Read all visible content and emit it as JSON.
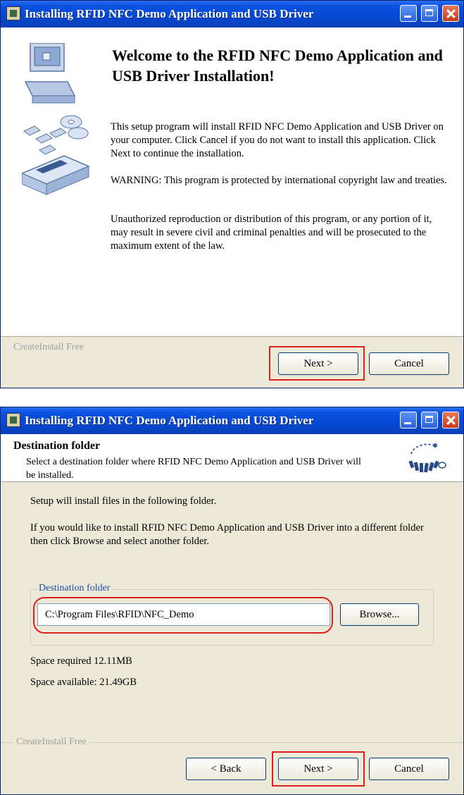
{
  "window1": {
    "title": "Installing RFID NFC Demo Application and USB Driver",
    "heading": "Welcome to the RFID NFC Demo Application and USB Driver Installation!",
    "para1": "This setup program will install RFID NFC Demo Application and USB Driver on your computer. Click Cancel if you do not want to install this application. Click Next to continue the installation.",
    "para2": "WARNING: This program is protected by international copyright law and treaties.",
    "para3": "Unauthorized reproduction or distribution of this program, or any portion of it, may result in severe civil and criminal penalties and will be prosecuted to the maximum extent of the law.",
    "brand": "CreateInstall Free",
    "next_label": "Next >",
    "cancel_label": "Cancel"
  },
  "window2": {
    "title": "Installing RFID NFC Demo Application and USB Driver",
    "header_title": "Destination folder",
    "header_subtitle": "Select a destination folder where RFID NFC Demo Application and USB Driver will be installed.",
    "line1": "Setup will install files in the following folder.",
    "line2": "If you would like to install RFID NFC Demo Application and USB Driver into a different folder then click Browse and select another folder.",
    "group_label": "Destination folder",
    "path_value": "C:\\Program Files\\RFID\\NFC_Demo",
    "browse_label": "Browse...",
    "space_required": "Space required 12.11MB",
    "space_available": "Space available: 21.49GB",
    "brand": "CreateInstall Free",
    "back_label": "< Back",
    "next_label": "Next >",
    "cancel_label": "Cancel"
  },
  "colors": {
    "titlebar": "#0548d2",
    "dialog_bg": "#ece9d8",
    "highlight": "#e02020",
    "group_label": "#1f4da8"
  },
  "icons": [
    "installer-app-icon",
    "minimize-icon",
    "maximize-icon",
    "close-icon",
    "computer-discs-illustration",
    "createinstall-logo-icon"
  ]
}
